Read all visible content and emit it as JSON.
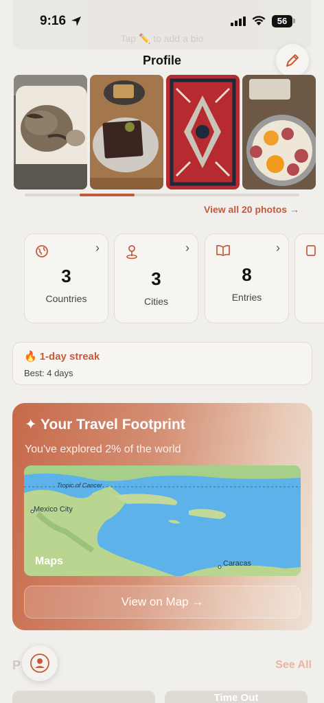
{
  "status_bar": {
    "time": "9:16",
    "battery": "56"
  },
  "header": {
    "title": "Profile"
  },
  "faded_top": {
    "ghost_text": "Tap ✏️ to add a bio"
  },
  "photos": {
    "items": [
      "cat-photo",
      "dessert-photo",
      "rug-photo",
      "eggs-photo"
    ],
    "view_all_label": "View all 20 photos →",
    "scroll_position": 0.2
  },
  "stats": [
    {
      "icon": "globe-icon",
      "value": "3",
      "label": "Countries"
    },
    {
      "icon": "pin-icon",
      "value": "3",
      "label": "Cities"
    },
    {
      "icon": "book-icon",
      "value": "8",
      "label": "Entries"
    }
  ],
  "streak": {
    "title": "1-day streak",
    "best": "Best: 4 days"
  },
  "footprint": {
    "title": "✦ Your Travel Footprint",
    "subtitle": "You've explored 2% of the world",
    "map_labels": {
      "tropic": "Tropic of Cancer",
      "city1": "Mexico City",
      "city2": "Caracas",
      "logo": "Maps"
    },
    "button_label": "View on Map →"
  },
  "bottom": {
    "section_title": "P",
    "see_all": "See All",
    "peek_card_text": "Time Out"
  },
  "colors": {
    "accent": "#c6593c",
    "background": "#f1efeb"
  }
}
